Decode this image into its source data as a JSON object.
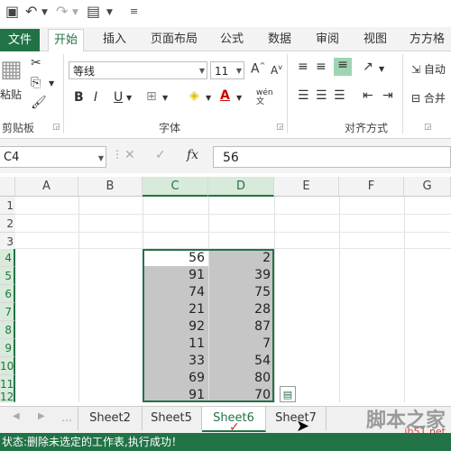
{
  "ribbon_tabs": {
    "file": "文件",
    "home": "开始",
    "insert": "插入",
    "layout": "页面布局",
    "formulas": "公式",
    "data": "数据",
    "review": "审阅",
    "view": "视图",
    "addin": "方方格子"
  },
  "clipboard": {
    "paste": "粘贴",
    "group": "剪贴板"
  },
  "font": {
    "name": "等线",
    "size": "11",
    "bold": "B",
    "italic": "I",
    "underline": "U",
    "group": "字体",
    "wen": "wén 文"
  },
  "alignment": {
    "wrap": "自动",
    "merge": "合并",
    "group": "对齐方式"
  },
  "formula_bar": {
    "name_box": "C4",
    "fx": "fx",
    "content": "56"
  },
  "columns": [
    "A",
    "B",
    "C",
    "D",
    "E",
    "F",
    "G"
  ],
  "rows": [
    "1",
    "2",
    "3",
    "4",
    "5",
    "6",
    "7",
    "8",
    "9",
    "10",
    "11",
    "12"
  ],
  "data": {
    "c": [
      "56",
      "91",
      "74",
      "21",
      "92",
      "11",
      "33",
      "69",
      "91"
    ],
    "d": [
      "2",
      "39",
      "75",
      "28",
      "87",
      "7",
      "54",
      "80",
      "70"
    ]
  },
  "sheets": [
    "Sheet2",
    "Sheet5",
    "Sheet6",
    "Sheet7"
  ],
  "active_sheet": "Sheet6",
  "status": "状态:删除未选定的工作表,执行成功！",
  "watermark": {
    "text": "脚本之家",
    "site": "jb51.net"
  },
  "colors": {
    "accent": "#217346",
    "selection": "#c6c6c6"
  }
}
